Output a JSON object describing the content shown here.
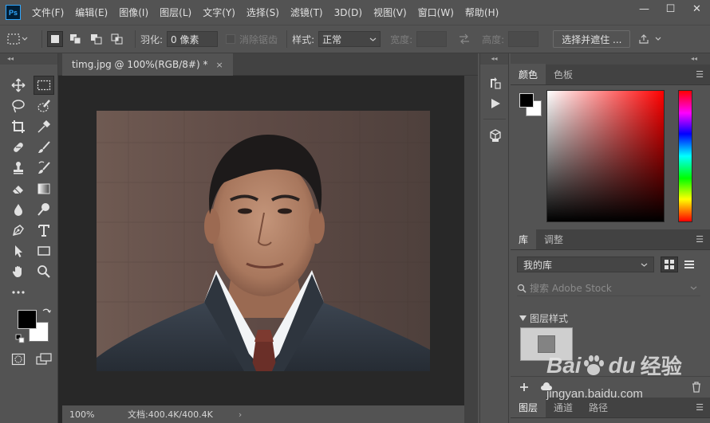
{
  "app": {
    "logo_text": "Ps"
  },
  "menu": [
    "文件(F)",
    "编辑(E)",
    "图像(I)",
    "图层(L)",
    "文字(Y)",
    "选择(S)",
    "滤镜(T)",
    "3D(D)",
    "视图(V)",
    "窗口(W)",
    "帮助(H)"
  ],
  "window_controls": {
    "minimize": "—",
    "maximize": "☐",
    "close": "✕"
  },
  "options_bar": {
    "feather_label": "羽化:",
    "feather_value": "0 像素",
    "antialias_label": "消除锯齿",
    "style_label": "样式:",
    "style_value": "正常",
    "width_label": "宽度:",
    "height_label": "高度:",
    "select_mask_label": "选择并遮住 ..."
  },
  "document": {
    "tab_title": "timg.jpg @ 100%(RGB/8#) *",
    "tab_close": "×",
    "zoom": "100%",
    "doc_info": "文档:400.4K/400.4K",
    "status_arrow": "›"
  },
  "panels": {
    "color_tabs": [
      "颜色",
      "色板"
    ],
    "library_tabs": [
      "库",
      "调整"
    ],
    "library_select": "我的库",
    "search_placeholder": "搜索 Adobe Stock",
    "layer_styles_label": "图层样式",
    "bottom_tabs": [
      "图层",
      "通道",
      "路径"
    ]
  },
  "colors": {
    "foreground": "#000000",
    "background": "#ffffff",
    "accent": "#31a8ff"
  },
  "watermark": {
    "logo_bai": "Bai",
    "logo_du": "du",
    "logo_jingyan": "经验",
    "url": "jingyan.baidu.com"
  }
}
